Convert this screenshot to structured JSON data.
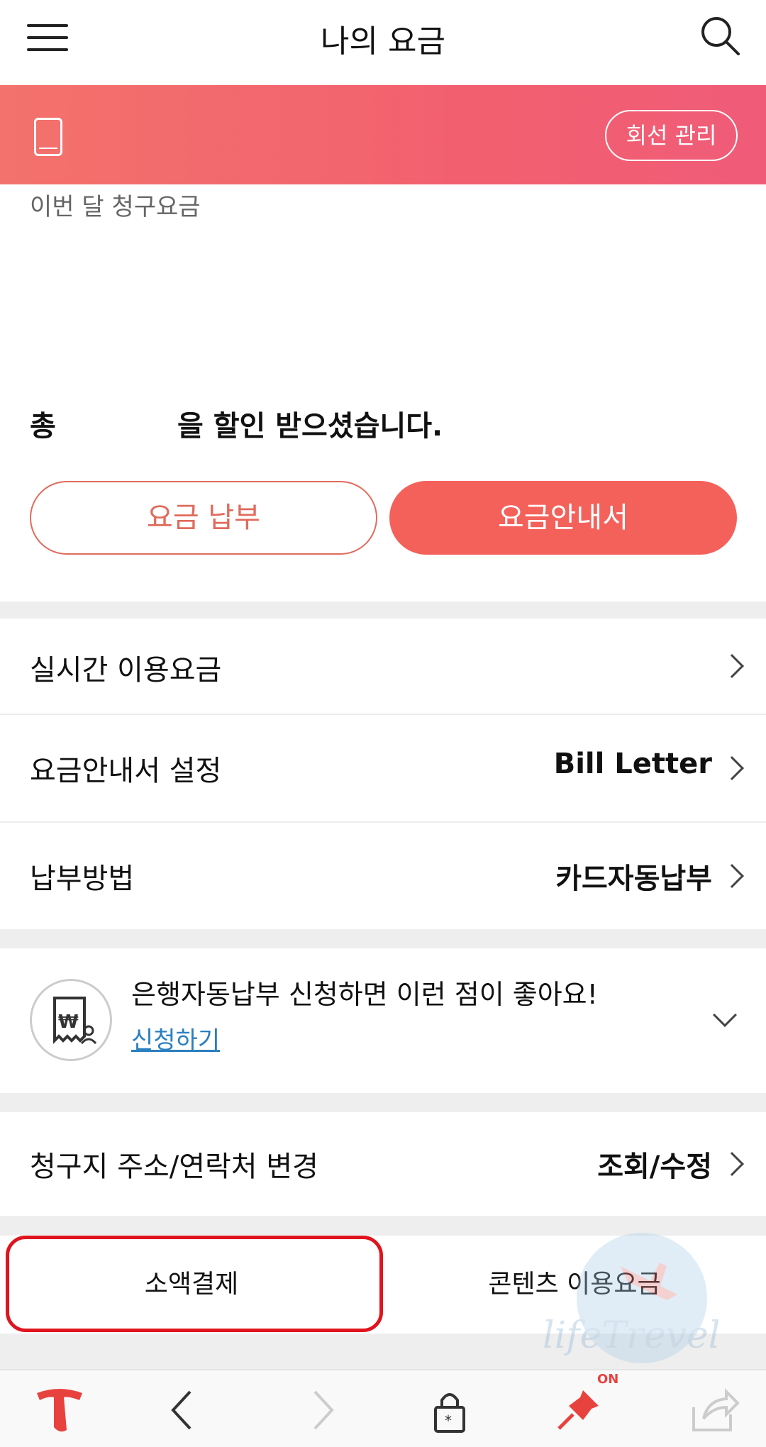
{
  "header": {
    "title": "나의 요금"
  },
  "banner": {
    "line_mgmt_label": "회선 관리"
  },
  "summary": {
    "bill_label": "이번 달 청구요금",
    "discount_prefix": "총",
    "discount_suffix": "을 할인 받으셨습니다."
  },
  "actions": {
    "pay_label": "요금 납부",
    "invoice_label": "요금안내서"
  },
  "rows": [
    {
      "label": "실시간 이용요금",
      "value": ""
    },
    {
      "label": "요금안내서 설정",
      "value": "Bill Letter"
    },
    {
      "label": "납부방법",
      "value": "카드자동납부"
    }
  ],
  "promo": {
    "title": "은행자동납부 신청하면 이런 점이 좋아요!",
    "link": "신청하기"
  },
  "address_row": {
    "label": "청구지 주소/연락처 변경",
    "value": "조회/수정"
  },
  "tabs": [
    {
      "label": "소액결제",
      "highlighted": true
    },
    {
      "label": "콘텐츠 이용요금",
      "highlighted": false
    }
  ],
  "watermark": {
    "text": "lifeTrevel"
  },
  "bottom_bar": {
    "items": [
      "t-logo-icon",
      "back-icon",
      "forward-icon",
      "lock-icon",
      "pin-icon",
      "share-icon"
    ],
    "pin_state_label": "ON"
  },
  "colors": {
    "accent": "#f4615b",
    "banner_start": "#f3726c",
    "banner_end": "#f05c78",
    "highlight": "#e0141e",
    "link": "#2a7fc0"
  }
}
